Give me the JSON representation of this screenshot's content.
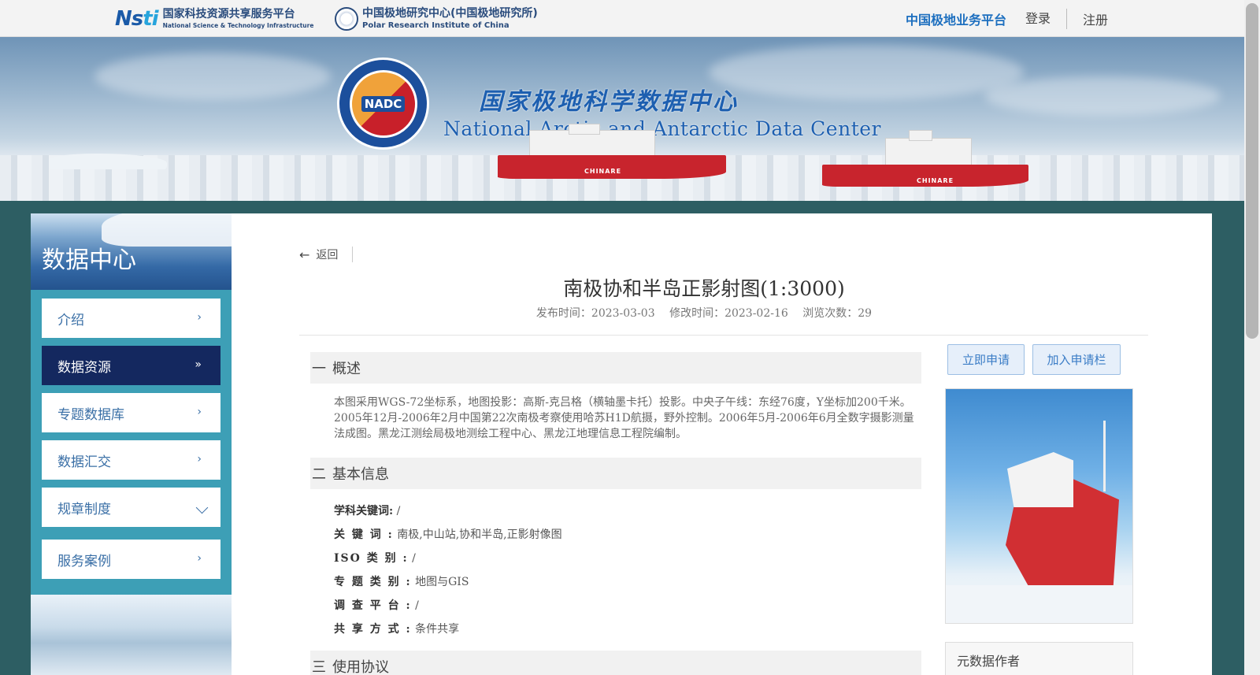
{
  "topbar": {
    "nsti_logo": {
      "mark": "Nsti",
      "cn": "国家科技资源共享服务平台",
      "en": "National Science & Technology Infrastructure"
    },
    "pric_logo": {
      "cn": "中国极地研究中心(中国极地研究所)",
      "en": "Polar Research Institute of China"
    },
    "platform_link": "中国极地业务平台",
    "login": "登录",
    "register": "注册"
  },
  "banner": {
    "logo_text": "NADC",
    "title_cn": "国家极地科学数据中心",
    "title_en": "National Arctic and Antarctic Data Center",
    "ship_label": "CHINARE"
  },
  "sidebar": {
    "title": "数据中心",
    "items": [
      {
        "label": "介绍",
        "icon": "chevron-right-icon",
        "active": false
      },
      {
        "label": "数据资源",
        "icon": "double-chevron-right-icon",
        "active": true
      },
      {
        "label": "专题数据库",
        "icon": "chevron-right-icon",
        "active": false
      },
      {
        "label": "数据汇交",
        "icon": "chevron-right-icon",
        "active": false
      },
      {
        "label": "规章制度",
        "icon": "chevron-down-icon",
        "active": false
      },
      {
        "label": "服务案例",
        "icon": "chevron-right-icon",
        "active": false
      }
    ]
  },
  "main": {
    "back_label": "返回",
    "title": "南极协和半岛正影射图(1:3000)",
    "meta": {
      "publish": "发布时间：2023-03-03",
      "modified": "修改时间：2023-02-16",
      "views": "浏览次数：29"
    },
    "sections": [
      {
        "num": "一",
        "title": "概述"
      },
      {
        "num": "二",
        "title": "基本信息"
      },
      {
        "num": "三",
        "title": "使用协议"
      }
    ],
    "description": "本图采用WGS-72坐标系，地图投影：高斯-克吕格（横轴墨卡托）投影。中央子午线：东经76度，Y坐标加200千米。2005年12月-2006年2月中国第22次南极考察使用哈苏H1D航摄，野外控制。2006年5月-2006年6月全数字摄影测量法成图。黑龙江测绘局极地测绘工程中心、黑龙江地理信息工程院编制。",
    "info": [
      {
        "key": "学科关键词:",
        "value": "/"
      },
      {
        "key": "关 键 词 :",
        "value": "南极,中山站,协和半岛,正影射像图"
      },
      {
        "key": "ISO 类 别 :",
        "value": "/"
      },
      {
        "key": "专 题 类 别 :",
        "value": "地图与GIS"
      },
      {
        "key": "调 查 平 台 :",
        "value": "/"
      },
      {
        "key": "共 享 方 式 :",
        "value": "条件共享"
      }
    ],
    "apply_button": "立即申请",
    "add_cart_button": "加入申请栏",
    "author_box_title": "元数据作者"
  },
  "colors": {
    "accent": "#1d6fbf",
    "nav_active": "#14285f",
    "sidebar_bg": "#3d9fb6",
    "button_bg": "#e6effa"
  }
}
